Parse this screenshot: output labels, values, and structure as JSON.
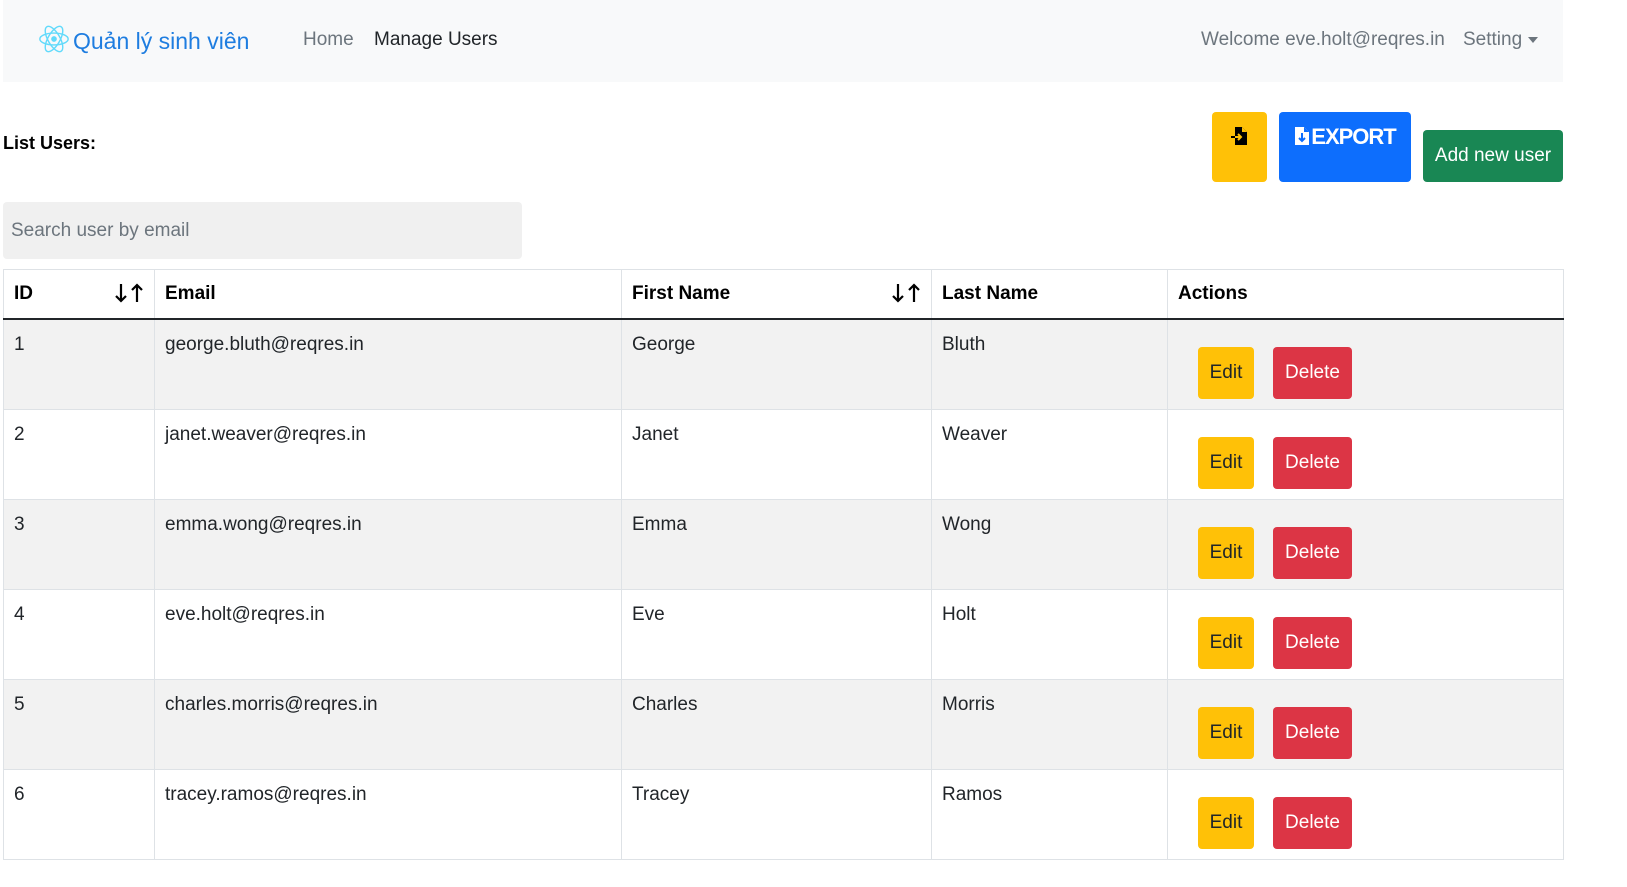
{
  "navbar": {
    "brand": "Quản lý sinh viên",
    "links": [
      "Home",
      "Manage Users"
    ],
    "welcome": "Welcome eve.holt@reqres.in",
    "setting": "Setting"
  },
  "toolbar": {
    "title": "List Users:",
    "import_icon": "file-import-icon",
    "export_label": "EXPORT",
    "export_icon": "file-download-icon",
    "add_label": "Add new user"
  },
  "search": {
    "placeholder": "Search user by email",
    "value": ""
  },
  "table": {
    "headers": {
      "id": "ID",
      "email": "Email",
      "first_name": "First Name",
      "last_name": "Last Name",
      "actions": "Actions"
    },
    "edit_label": "Edit",
    "delete_label": "Delete",
    "rows": [
      {
        "id": "1",
        "email": "george.bluth@reqres.in",
        "first_name": "George",
        "last_name": "Bluth"
      },
      {
        "id": "2",
        "email": "janet.weaver@reqres.in",
        "first_name": "Janet",
        "last_name": "Weaver"
      },
      {
        "id": "3",
        "email": "emma.wong@reqres.in",
        "first_name": "Emma",
        "last_name": "Wong"
      },
      {
        "id": "4",
        "email": "eve.holt@reqres.in",
        "first_name": "Eve",
        "last_name": "Holt"
      },
      {
        "id": "5",
        "email": "charles.morris@reqres.in",
        "first_name": "Charles",
        "last_name": "Morris"
      },
      {
        "id": "6",
        "email": "tracey.ramos@reqres.in",
        "first_name": "Tracey",
        "last_name": "Ramos"
      }
    ]
  },
  "colors": {
    "brand": "#1e7de0",
    "warning": "#ffc107",
    "primary": "#0d6efd",
    "success": "#198754",
    "danger": "#dc3545"
  }
}
